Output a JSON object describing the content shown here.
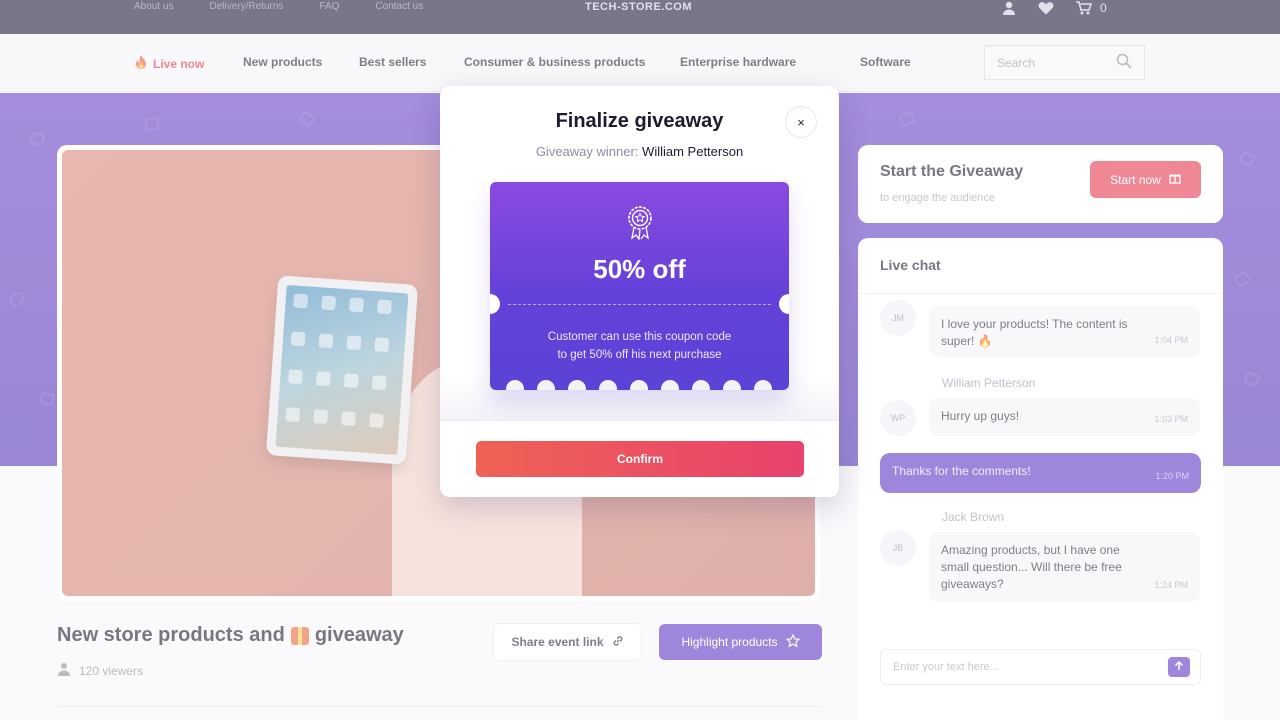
{
  "topbar": {
    "links": [
      "About us",
      "Delivery/Returns",
      "FAQ",
      "Contact us"
    ],
    "brand": "TECH-STORE.COM",
    "cart_count": "0",
    "icons": [
      "user-icon",
      "heart-icon",
      "cart-icon"
    ]
  },
  "nav": {
    "live_label": "Live now",
    "items": [
      "New products",
      "Best sellers",
      "Consumer & business products",
      "Enterprise hardware",
      "Software"
    ],
    "search_placeholder": "Search"
  },
  "event": {
    "title": "New store products and",
    "title_suffix": "giveaway",
    "viewers": "120 viewers",
    "share_label": "Share event link",
    "highlight_label": "Highlight products"
  },
  "giveaway_card": {
    "title": "Start the Giveaway",
    "subtitle": "to engage the audience",
    "button_label": "Start now"
  },
  "chat": {
    "title": "Live chat",
    "messages": [
      {
        "initials": "JM",
        "name": "",
        "text": "I love your products! The content is super! 🔥",
        "time": "1:04 PM"
      },
      {
        "initials": "WP",
        "name": "William Petterson",
        "text": "Hurry up guys!",
        "time": "1:03 PM"
      },
      {
        "initials": "",
        "name": "",
        "text": "Thanks for the comments!",
        "time": "1:20 PM"
      },
      {
        "initials": "JB",
        "name": "Jack Brown",
        "text": "Amazing products, but I have one small question... Will there be free giveaways?",
        "time": "1:24 PM"
      }
    ],
    "input_placeholder": "Enter your text here..."
  },
  "modal": {
    "title": "Finalize giveaway",
    "winner_label": "Giveaway winner:",
    "winner_name": "William Petterson",
    "coupon_value": "50% off",
    "coupon_desc_line1": "Customer can use this coupon code",
    "coupon_desc_line2": "to get 50% off his next purchase",
    "confirm_label": "Confirm",
    "close_glyph": "×"
  },
  "colors": {
    "accent_purple": "#5d36c4",
    "live_red": "#e5384f",
    "confirm_gradient_start": "#ee6254",
    "confirm_gradient_end": "#e8426e"
  }
}
